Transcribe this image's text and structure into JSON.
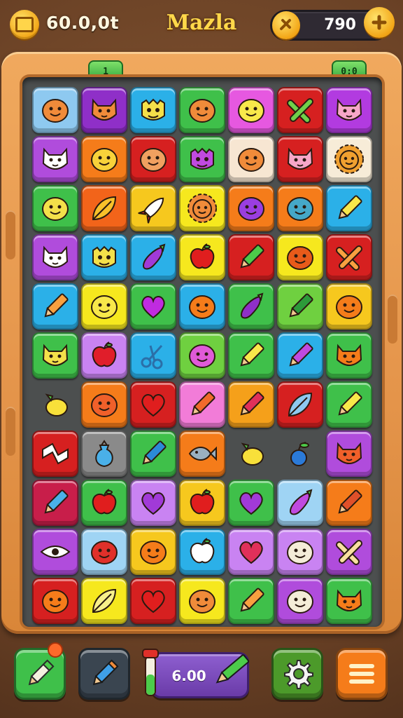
{
  "header": {
    "score_text": "60.0,0t",
    "title": "Mazla",
    "coins": "790"
  },
  "board": {
    "tab_left_label": "1",
    "tab_right_label": "0:0",
    "tiles": [
      [
        {
          "color": "#8ec9f0",
          "icon": "smiley-face-icon",
          "glyph": "face",
          "fg": "#f08b3a"
        },
        {
          "color": "#8f2fc8",
          "icon": "cat-face-icon",
          "glyph": "cat",
          "fg": "#f08b3a"
        },
        {
          "color": "#2bb0e8",
          "icon": "monster-face-icon",
          "glyph": "monster",
          "fg": "#f4e04a"
        },
        {
          "color": "#3fc04a",
          "icon": "monkey-face-icon",
          "glyph": "face",
          "fg": "#f08b3a"
        },
        {
          "color": "#e658e0",
          "icon": "smiley-face-icon",
          "glyph": "face",
          "fg": "#f8e84a"
        },
        {
          "color": "#d62020",
          "icon": "tools-icon",
          "glyph": "cross",
          "fg": "#6fd04a"
        },
        {
          "color": "#b23be0",
          "icon": "pig-face-icon",
          "glyph": "cat",
          "fg": "#f7a6c8"
        }
      ],
      [
        {
          "color": "#b04cdc",
          "icon": "cat-face-icon",
          "glyph": "cat",
          "fg": "#ffffff"
        },
        {
          "color": "#f57c1a",
          "icon": "smiley-face-icon",
          "glyph": "face",
          "fg": "#f8d23a"
        },
        {
          "color": "#d62020",
          "icon": "smiley-face-icon",
          "glyph": "face",
          "fg": "#f0a060"
        },
        {
          "color": "#3fc04a",
          "icon": "monster-face-icon",
          "glyph": "monster",
          "fg": "#c04ae0"
        },
        {
          "color": "#f7e6d2",
          "icon": "smiley-face-icon",
          "glyph": "face",
          "fg": "#f08b3a"
        },
        {
          "color": "#d62020",
          "icon": "pig-face-icon",
          "glyph": "cat",
          "fg": "#f7a6c8"
        },
        {
          "color": "#f7ecd8",
          "icon": "lion-face-icon",
          "glyph": "sun",
          "fg": "#f0a030"
        }
      ],
      [
        {
          "color": "#3fc04a",
          "icon": "smiley-face-icon",
          "glyph": "face",
          "fg": "#f4e04a"
        },
        {
          "color": "#f2641a",
          "icon": "leaf-icon",
          "glyph": "leaf",
          "fg": "#f8c02a"
        },
        {
          "color": "#f6c81e",
          "icon": "rocket-icon",
          "glyph": "rocket",
          "fg": "#ffffff"
        },
        {
          "color": "#f6e81e",
          "icon": "lion-face-icon",
          "glyph": "sun",
          "fg": "#f08b3a"
        },
        {
          "color": "#f57c1a",
          "icon": "monster-face-icon",
          "glyph": "face",
          "fg": "#9a3ee0"
        },
        {
          "color": "#f57c1a",
          "icon": "monster-face-icon",
          "glyph": "face",
          "fg": "#45a8c8"
        },
        {
          "color": "#2bb0e8",
          "icon": "pencil-icon",
          "glyph": "pencil",
          "fg": "#f8e84a"
        }
      ],
      [
        {
          "color": "#b04cdc",
          "icon": "cat-face-icon",
          "glyph": "cat",
          "fg": "#ffffff"
        },
        {
          "color": "#2bb0e8",
          "icon": "monster-face-icon",
          "glyph": "monster",
          "fg": "#f4e04a"
        },
        {
          "color": "#2bb0e8",
          "icon": "eggplant-icon",
          "glyph": "eggplant",
          "fg": "#a13ad8"
        },
        {
          "color": "#f6e81e",
          "icon": "apple-icon",
          "glyph": "apple",
          "fg": "#e01e1e"
        },
        {
          "color": "#d62020",
          "icon": "pencil-icon",
          "glyph": "pencil",
          "fg": "#4ccc4a"
        },
        {
          "color": "#f6e81e",
          "icon": "smiley-face-icon",
          "glyph": "face",
          "fg": "#e85a1a"
        },
        {
          "color": "#d62020",
          "icon": "tools-icon",
          "glyph": "cross",
          "fg": "#f8a040"
        }
      ],
      [
        {
          "color": "#2bb0e8",
          "icon": "pencil-icon",
          "glyph": "pencil",
          "fg": "#f8a040"
        },
        {
          "color": "#f6e81e",
          "icon": "smiley-face-icon",
          "glyph": "face",
          "fg": "#f8e84a"
        },
        {
          "color": "#3fc04a",
          "icon": "heart-icon",
          "glyph": "heart",
          "fg": "#c02be0"
        },
        {
          "color": "#2bb0e8",
          "icon": "orange-icon",
          "glyph": "face",
          "fg": "#f57c1a"
        },
        {
          "color": "#3fc04a",
          "icon": "eggplant-icon",
          "glyph": "eggplant",
          "fg": "#8f2fc8"
        },
        {
          "color": "#6fd040",
          "icon": "pencil-icon",
          "glyph": "pencil",
          "fg": "#2c9a3a"
        },
        {
          "color": "#f6c81e",
          "icon": "smiley-face-icon",
          "glyph": "face",
          "fg": "#f57c1a"
        }
      ],
      [
        {
          "color": "#3fc04a",
          "icon": "monkey-face-icon",
          "glyph": "cat",
          "fg": "#f4e04a"
        },
        {
          "color": "#c983f2",
          "icon": "strawberry-icon",
          "glyph": "apple",
          "fg": "#e01e2a"
        },
        {
          "color": "#2bb0e8",
          "icon": "scissors-icon",
          "glyph": "scissors",
          "fg": "#2b6fa8"
        },
        {
          "color": "#6fd040",
          "icon": "berry-face-icon",
          "glyph": "face",
          "fg": "#e05ad8"
        },
        {
          "color": "#3fc04a",
          "icon": "pencil-icon",
          "glyph": "pencil",
          "fg": "#f8e84a"
        },
        {
          "color": "#2bb0e8",
          "icon": "pencil-icon",
          "glyph": "pencil",
          "fg": "#c04ae0"
        },
        {
          "color": "#3fc04a",
          "icon": "fox-face-icon",
          "glyph": "cat",
          "fg": "#f57c1a"
        }
      ],
      [
        {
          "color": "empty",
          "icon": "lemon-icon",
          "glyph": "lemon",
          "fg": "#f8e03a"
        },
        {
          "color": "#f57c1a",
          "icon": "smiley-face-icon",
          "glyph": "face",
          "fg": "#f0602a"
        },
        {
          "color": "#d62020",
          "icon": "heart-icon",
          "glyph": "heart",
          "fg": "#e01e1e"
        },
        {
          "color": "#f27cd8",
          "icon": "pencil-icon",
          "glyph": "pencil",
          "fg": "#f06a2a"
        },
        {
          "color": "#f5a01a",
          "icon": "pencil-icon",
          "glyph": "pencil",
          "fg": "#e0305a"
        },
        {
          "color": "#d62020",
          "icon": "feather-icon",
          "glyph": "leaf",
          "fg": "#8ec9f0"
        },
        {
          "color": "#3fc04a",
          "icon": "pencil-icon",
          "glyph": "pencil",
          "fg": "#f8e84a"
        }
      ],
      [
        {
          "color": "#d62020",
          "icon": "candy-icon",
          "glyph": "zigzag",
          "fg": "#ffffff"
        },
        {
          "color": "#8a8a8a",
          "icon": "bag-icon",
          "glyph": "bag",
          "fg": "#4ab0e8"
        },
        {
          "color": "#3fc04a",
          "icon": "pencil-icon",
          "glyph": "pencil",
          "fg": "#2b8ad8"
        },
        {
          "color": "#f57c1a",
          "icon": "fish-icon",
          "glyph": "fish",
          "fg": "#9ab0c0"
        },
        {
          "color": "empty",
          "icon": "lemon-icon",
          "glyph": "lemon",
          "fg": "#f8e03a"
        },
        {
          "color": "empty",
          "icon": "berry-icon",
          "glyph": "berry",
          "fg": "#2b7ad8"
        },
        {
          "color": "#b04cdc",
          "icon": "fox-face-icon",
          "glyph": "cat",
          "fg": "#f0602a"
        }
      ],
      [
        {
          "color": "#c81e4a",
          "icon": "pencil-icon",
          "glyph": "pencil",
          "fg": "#4ab0e8"
        },
        {
          "color": "#3fc04a",
          "icon": "apple-icon",
          "glyph": "apple",
          "fg": "#e01e1e"
        },
        {
          "color": "#c983f2",
          "icon": "heart-icon",
          "glyph": "heart",
          "fg": "#a13ad8"
        },
        {
          "color": "#f6c81e",
          "icon": "apple-icon",
          "glyph": "apple",
          "fg": "#e01e1e"
        },
        {
          "color": "#3fc04a",
          "icon": "heart-icon",
          "glyph": "heart",
          "fg": "#a13ad8"
        },
        {
          "color": "#9fd4f4",
          "icon": "eggplant-icon",
          "glyph": "eggplant",
          "fg": "#c04ae0"
        },
        {
          "color": "#f57c1a",
          "icon": "pencil-icon",
          "glyph": "pencil",
          "fg": "#e0502a"
        }
      ],
      [
        {
          "color": "#b04cdc",
          "icon": "eye-icon",
          "glyph": "eye",
          "fg": "#ffffff"
        },
        {
          "color": "#9fd4f4",
          "icon": "smiley-face-icon",
          "glyph": "face",
          "fg": "#e0302a"
        },
        {
          "color": "#f6c81e",
          "icon": "smiley-face-icon",
          "glyph": "face",
          "fg": "#f57c1a"
        },
        {
          "color": "#2bb0e8",
          "icon": "peach-icon",
          "glyph": "apple",
          "fg": "#ffffff"
        },
        {
          "color": "#c983f2",
          "icon": "lips-icon",
          "glyph": "heart",
          "fg": "#e0305a"
        },
        {
          "color": "#c983f2",
          "icon": "ghost-face-icon",
          "glyph": "face",
          "fg": "#f4ecd8"
        },
        {
          "color": "#b04cdc",
          "icon": "cross-icon",
          "glyph": "cross",
          "fg": "#f8e0a0"
        }
      ],
      [
        {
          "color": "#d62020",
          "icon": "smiley-face-icon",
          "glyph": "face",
          "fg": "#f57c1a"
        },
        {
          "color": "#f6e81e",
          "icon": "leaf-icon",
          "glyph": "leaf",
          "fg": "#f8f08a"
        },
        {
          "color": "#d62020",
          "icon": "heart-icon",
          "glyph": "heart",
          "fg": "#e01e1e"
        },
        {
          "color": "#f6e81e",
          "icon": "smiley-face-icon",
          "glyph": "face",
          "fg": "#f08b3a"
        },
        {
          "color": "#3fc04a",
          "icon": "pencil-icon",
          "glyph": "pencil",
          "fg": "#f8a040"
        },
        {
          "color": "#b04cdc",
          "icon": "ghost-face-icon",
          "glyph": "face",
          "fg": "#f4ecd8"
        },
        {
          "color": "#3fc04a",
          "icon": "fox-face-icon",
          "glyph": "cat",
          "fg": "#f57c1a"
        }
      ]
    ]
  },
  "footer": {
    "power_value": "6.00",
    "colors": {
      "pencil_btn": "#3fc04a",
      "edit_btn": "#3a4550",
      "settings_btn": "#4c9a2a",
      "menu_btn": "#f57c1a"
    }
  }
}
